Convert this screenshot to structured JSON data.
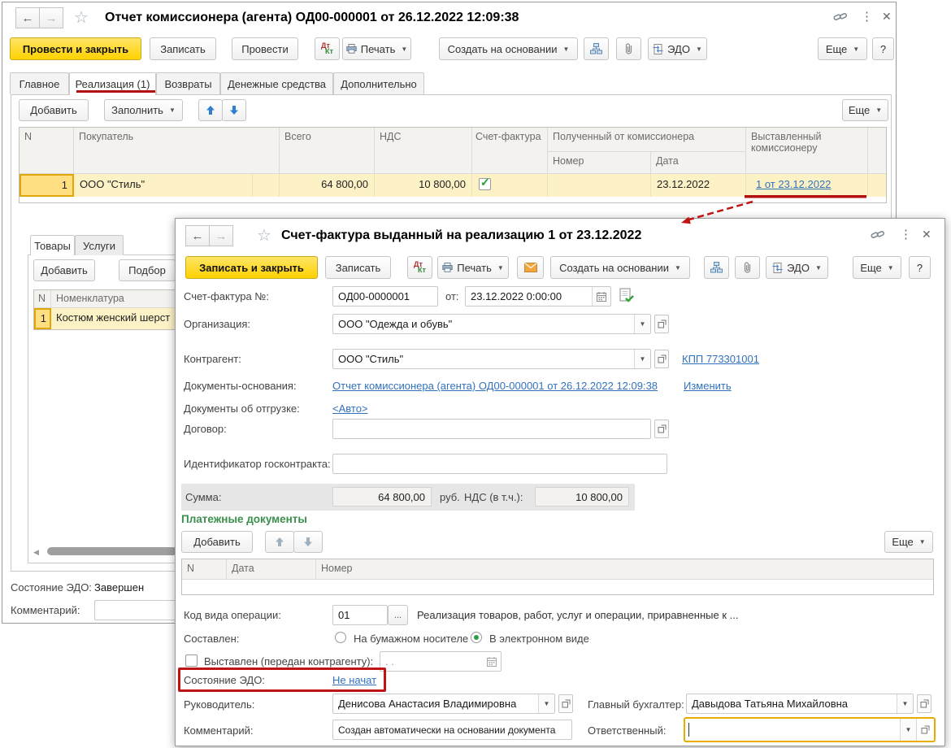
{
  "bg": {
    "title": "Отчет комиссионера (агента) ОД00-000001 от 26.12.2022 12:09:38",
    "toolbar": {
      "post_close": "Провести и закрыть",
      "save": "Записать",
      "post": "Провести",
      "dt": "Дт",
      "kt": "Кт",
      "print": "Печать",
      "create_on_base": "Создать на основании",
      "edo": "ЭДО",
      "more": "Еще",
      "help": "?"
    },
    "tabs": [
      "Главное",
      "Реализация (1)",
      "Возвраты",
      "Денежные средства",
      "Дополнительно"
    ],
    "cmd": {
      "add": "Добавить",
      "fill": "Заполнить",
      "more": "Еще"
    },
    "table": {
      "h_n": "N",
      "h_buyer": "Покупатель",
      "h_total": "Всего",
      "h_vat": "НДС",
      "h_invoice": "Счет-фактура",
      "h_received": "Полученный от комиссионера",
      "h_number": "Номер",
      "h_date": "Дата",
      "h_issued": "Выставленный комиссионеру",
      "row": {
        "n": "1",
        "buyer": "ООО \"Стиль\"",
        "total": "64 800,00",
        "vat": "10 800,00",
        "date": "23.12.2022",
        "issued_link": "1 от 23.12.2022"
      }
    },
    "lower": {
      "tab_goods": "Товары",
      "tab_services": "Услуги",
      "add": "Добавить",
      "pick": "Подбор",
      "h_n": "N",
      "h_nomenclature": "Номенклатура",
      "row_n": "1",
      "row_item": "Костюм женский шерст"
    },
    "edo_label": "Состояние ЭДО:",
    "edo_state": "Завершен",
    "comment_label": "Комментарий:"
  },
  "fg": {
    "title": "Счет-фактура выданный на реализацию 1 от 23.12.2022",
    "toolbar": {
      "save_close": "Записать и закрыть",
      "save": "Записать",
      "dt": "Дт",
      "kt": "Кт",
      "print": "Печать",
      "create_on_base": "Создать на основании",
      "edo": "ЭДО",
      "more": "Еще",
      "help": "?"
    },
    "fields": {
      "number_label": "Счет-фактура №:",
      "number": "ОД00-0000001",
      "from_label": "от:",
      "date": "23.12.2022  0:00:00",
      "org_label": "Организация:",
      "org": "ООО \"Одежда и обувь\"",
      "contractor_label": "Контрагент:",
      "contractor": "ООО \"Стиль\"",
      "kpp_link": "КПП 773301001",
      "base_docs_label": "Документы-основания:",
      "base_docs_link": "Отчет комиссионера (агента) ОД00-000001 от 26.12.2022 12:09:38",
      "change_link": "Изменить",
      "shipping_docs_label": "Документы об отгрузке:",
      "shipping_docs_link": "<Авто>",
      "contract_label": "Договор:",
      "gov_contract_label": "Идентификатор госконтракта:",
      "sum_label": "Сумма:",
      "sum": "64 800,00",
      "rub": "руб.",
      "vat_label": "НДС (в т.ч.):",
      "vat": "10 800,00"
    },
    "payments": {
      "title": "Платежные документы",
      "add": "Добавить",
      "more": "Еще",
      "h_n": "N",
      "h_date": "Дата",
      "h_number": "Номер"
    },
    "op": {
      "label": "Код вида операции:",
      "code": "01",
      "dots": "...",
      "desc": "Реализация товаров, работ, услуг и операции, приравненные к ..."
    },
    "composed": {
      "label": "Составлен:",
      "paper": "На бумажном носителе",
      "electronic": "В электронном виде"
    },
    "issued": {
      "label": "Выставлен (передан контрагенту):",
      "date_placeholder": ".  ."
    },
    "edo": {
      "label": "Состояние ЭДО:",
      "link": "Не начат"
    },
    "bottom": {
      "head_label": "Руководитель:",
      "head": "Денисова Анастасия Владимировна",
      "accountant_label": "Главный бухгалтер:",
      "accountant": "Давыдова Татьяна Михайловна",
      "comment_label": "Комментарий:",
      "comment": "Создан автоматически на основании документа",
      "responsible_label": "Ответственный:"
    }
  }
}
